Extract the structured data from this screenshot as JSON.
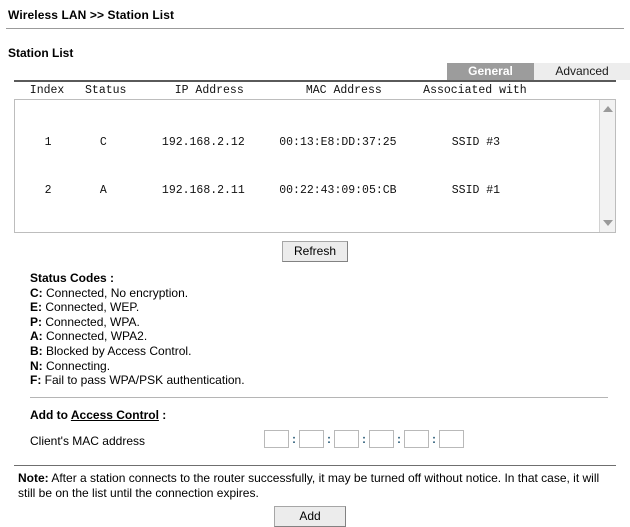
{
  "breadcrumb": "Wireless LAN >> Station List",
  "section_title": "Station List",
  "tabs": [
    {
      "label": "General",
      "active": true
    },
    {
      "label": "Advanced",
      "active": false
    }
  ],
  "station_table": {
    "columns": [
      "Index",
      "Status",
      "IP Address",
      "MAC Address",
      "Associated with"
    ],
    "header_line": "  Index   Status       IP Address         MAC Address      Associated with",
    "rows": [
      {
        "index": "1",
        "status": "C",
        "ip_address": "192.168.2.12",
        "mac_address": "00:13:E8:DD:37:25",
        "associated_with": "SSID #3",
        "line": "    1       C        192.168.2.12     00:13:E8:DD:37:25        SSID #3"
      },
      {
        "index": "2",
        "status": "A",
        "ip_address": "192.168.2.11",
        "mac_address": "00:22:43:09:05:CB",
        "associated_with": "SSID #1",
        "line": "    2       A        192.168.2.11     00:22:43:09:05:CB        SSID #1"
      }
    ]
  },
  "refresh_button": "Refresh",
  "status_codes": {
    "title": "Status Codes :",
    "items": [
      {
        "key": "C:",
        "text": " Connected, No encryption."
      },
      {
        "key": "E:",
        "text": " Connected, WEP."
      },
      {
        "key": "P:",
        "text": " Connected, WPA."
      },
      {
        "key": "A:",
        "text": " Connected, WPA2."
      },
      {
        "key": "B:",
        "text": " Blocked by Access Control."
      },
      {
        "key": "N:",
        "text": " Connecting."
      },
      {
        "key": "F:",
        "text": " Fail to pass WPA/PSK authentication."
      }
    ]
  },
  "access_control": {
    "prefix": "Add to ",
    "link": "Access Control",
    "suffix": " :"
  },
  "mac_input": {
    "label": "Client's MAC address",
    "separator": ":",
    "octets": [
      "",
      "",
      "",
      "",
      "",
      ""
    ],
    "placeholder": ""
  },
  "note": {
    "label": "Note:",
    "text": " After a station connects to the router successfully, it may be turned off without notice. In that case, it will still be on the list until the connection expires."
  },
  "add_button": "Add",
  "colors": {
    "active_tab_bg": "#9c9c9c",
    "inactive_tab_bg": "#ededed",
    "panel_top_border": "#5a5a5a",
    "button_bg": "#ececec"
  }
}
